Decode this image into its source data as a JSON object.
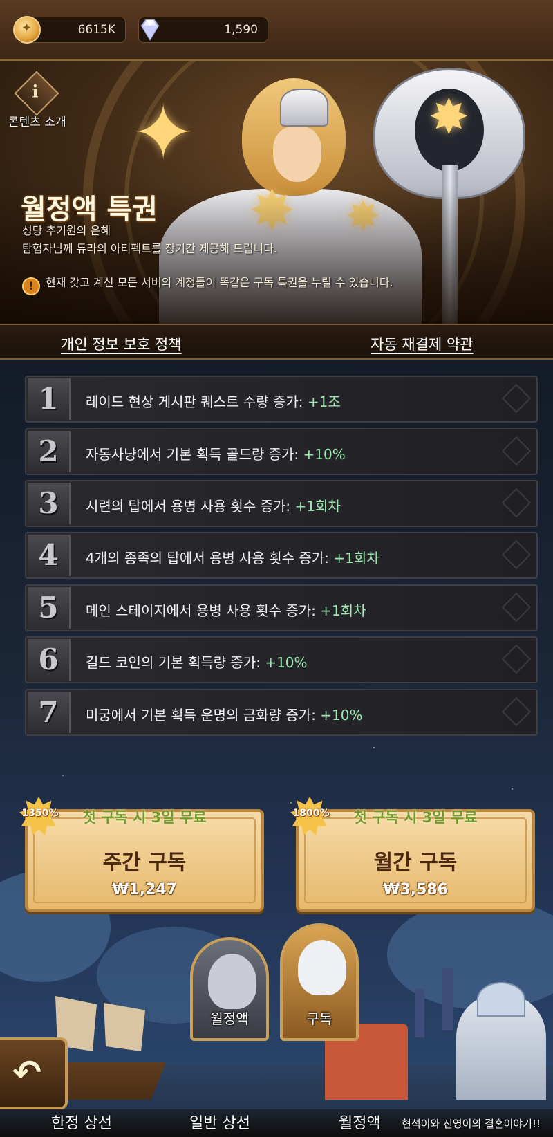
{
  "currency": {
    "gold": {
      "icon": "gold-coin-icon",
      "value": "6615K"
    },
    "gems": {
      "icon": "diamond-icon",
      "value": "1,590"
    }
  },
  "info": {
    "icon": "info-icon",
    "glyph": "i",
    "label": "콘텐츠 소개"
  },
  "hero": {
    "title": "월정액 특권",
    "subtitle": "성당 추기원의 은혜",
    "description": "탐험자님께 듀라의 아티펙트를 장기간 제공해 드립니다.",
    "notice_glyph": "!",
    "notice": "현재 갖고 계신 모든 서버의 계정들이 똑같은 구독 특권을 누릴 수 있습니다."
  },
  "links": {
    "privacy": "개인 정보 보호 정책",
    "auto_renew": "자동 재결제 약관"
  },
  "benefits": [
    {
      "num": "1",
      "text": "레이드 현상 게시판 퀘스트 수량 증가:",
      "bonus": "+1조"
    },
    {
      "num": "2",
      "text": "자동사냥에서 기본 획득 골드량 증가:",
      "bonus": "+10%"
    },
    {
      "num": "3",
      "text": "시련의 탑에서 용병 사용 횟수 증가:",
      "bonus": "+1회차"
    },
    {
      "num": "4",
      "text": "4개의 종족의 탑에서 용병 사용 횟수 증가:",
      "bonus": "+1회차"
    },
    {
      "num": "5",
      "text": "메인 스테이지에서 용병 사용 횟수 증가:",
      "bonus": "+1회차"
    },
    {
      "num": "6",
      "text": "길드 코인의 기본 획득량 증가:",
      "bonus": "+10%"
    },
    {
      "num": "7",
      "text": "미궁에서 기본 획득 운명의 금화량 증가:",
      "bonus": "+10%"
    }
  ],
  "plans": {
    "weekly": {
      "badge": "1350%",
      "promo": "첫 구독 시 3일 무료",
      "name": "주간 구독",
      "price": "₩1,247"
    },
    "monthly": {
      "badge": "1800%",
      "promo": "첫 구독 시 3일 무료",
      "name": "월간 구독",
      "price": "₩3,586"
    }
  },
  "portraits": {
    "monthly_pass": "월정액",
    "subscription": "구독"
  },
  "back": {
    "icon": "back-arrow-icon",
    "glyph": "↶"
  },
  "nav": {
    "limited_shop": "한정 상선",
    "general_shop": "일반 상선",
    "monthly": "월정액"
  },
  "watermark": "현석이와 진영이의 결혼이야기!!"
}
